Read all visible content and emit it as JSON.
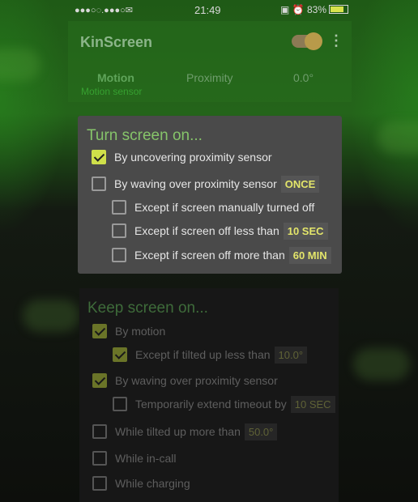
{
  "status_bar": {
    "left_icons": "●●●○◌.●●●○✉",
    "time": "21:49",
    "right_icons": "▣ ⏰",
    "battery": "83%"
  },
  "app": {
    "title": "KinScreen",
    "toggle_on": true,
    "tabs": [
      {
        "label": "Motion"
      },
      {
        "label": "Proximity"
      },
      {
        "label": "0.0°"
      }
    ],
    "tab_sub": "Motion sensor"
  },
  "dialog": {
    "title": "Turn screen on...",
    "items": [
      {
        "label": "By uncovering proximity sensor",
        "checked": true,
        "value": ""
      },
      {
        "label": "By waving over proximity sensor",
        "checked": false,
        "value": "ONCE"
      },
      {
        "label": "Except if screen manually turned off",
        "checked": false,
        "value": ""
      },
      {
        "label": "Except if screen off less than",
        "checked": false,
        "value": "10 SEC"
      },
      {
        "label": "Except if screen off more than",
        "checked": false,
        "value": "60 MIN"
      }
    ]
  },
  "keep_on": {
    "title": "Keep screen on...",
    "items": [
      {
        "label": "By motion",
        "checked": true,
        "value": ""
      },
      {
        "label": "Except if tilted up less than",
        "checked": true,
        "value": "10.0°"
      },
      {
        "label": "By waving over proximity sensor",
        "checked": true,
        "value": ""
      },
      {
        "label": "Temporarily extend timeout by",
        "checked": false,
        "value": "10 SEC"
      },
      {
        "label": "While tilted up more than",
        "checked": false,
        "value": "50.0°"
      },
      {
        "label": "While in-call",
        "checked": false,
        "value": ""
      },
      {
        "label": "While charging",
        "checked": false,
        "value": ""
      }
    ]
  },
  "colors": {
    "accent_green": "#86c46a",
    "value_yellow": "#e3e56a",
    "checkbox_yellow": "#cfe04a"
  }
}
